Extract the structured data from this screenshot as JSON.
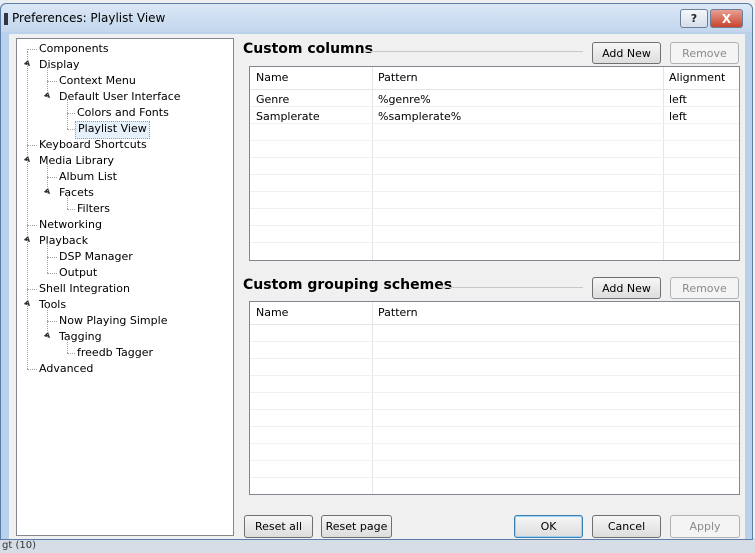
{
  "window": {
    "title": "Preferences: Playlist View",
    "help_glyph": "?",
    "close_glyph": "X"
  },
  "background": {
    "bottom_text": "gt (10)"
  },
  "tree": [
    {
      "label": "Components",
      "level": 0,
      "expander": false
    },
    {
      "label": "Display",
      "level": 0,
      "expander": true
    },
    {
      "label": "Context Menu",
      "level": 1,
      "expander": false
    },
    {
      "label": "Default User Interface",
      "level": 1,
      "expander": true
    },
    {
      "label": "Colors and Fonts",
      "level": 2,
      "expander": false
    },
    {
      "label": "Playlist View",
      "level": 2,
      "expander": false,
      "selected": true
    },
    {
      "label": "Keyboard Shortcuts",
      "level": 0,
      "expander": false
    },
    {
      "label": "Media Library",
      "level": 0,
      "expander": true
    },
    {
      "label": "Album List",
      "level": 1,
      "expander": false
    },
    {
      "label": "Facets",
      "level": 1,
      "expander": true
    },
    {
      "label": "Filters",
      "level": 2,
      "expander": false
    },
    {
      "label": "Networking",
      "level": 0,
      "expander": false
    },
    {
      "label": "Playback",
      "level": 0,
      "expander": true
    },
    {
      "label": "DSP Manager",
      "level": 1,
      "expander": false
    },
    {
      "label": "Output",
      "level": 1,
      "expander": false
    },
    {
      "label": "Shell Integration",
      "level": 0,
      "expander": false
    },
    {
      "label": "Tools",
      "level": 0,
      "expander": true
    },
    {
      "label": "Now Playing Simple",
      "level": 1,
      "expander": false
    },
    {
      "label": "Tagging",
      "level": 1,
      "expander": true
    },
    {
      "label": "freedb Tagger",
      "level": 2,
      "expander": false
    },
    {
      "label": "Advanced",
      "level": 0,
      "expander": false
    }
  ],
  "custom_columns": {
    "title": "Custom columns",
    "add_label": "Add New",
    "remove_label": "Remove",
    "headers": [
      "Name",
      "Pattern",
      "Alignment"
    ],
    "rows": [
      [
        "Genre",
        "%genre%",
        "left"
      ],
      [
        "Samplerate",
        "%samplerate%",
        "left"
      ]
    ]
  },
  "grouping": {
    "title": "Custom grouping schemes",
    "add_label": "Add New",
    "remove_label": "Remove",
    "headers": [
      "Name",
      "Pattern"
    ],
    "rows": []
  },
  "footer": {
    "reset_all": "Reset all",
    "reset_page": "Reset page",
    "ok": "OK",
    "cancel": "Cancel",
    "apply": "Apply"
  }
}
